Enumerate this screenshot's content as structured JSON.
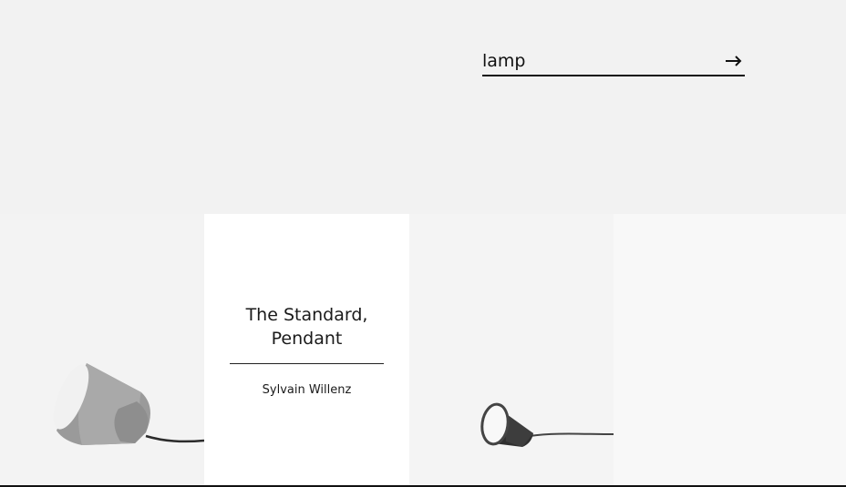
{
  "search": {
    "value": "lamp",
    "submit_icon": "arrow-right-icon"
  },
  "products": [
    {
      "title": "The Standard, Pendant",
      "designer": "Sylvain Willenz"
    }
  ]
}
